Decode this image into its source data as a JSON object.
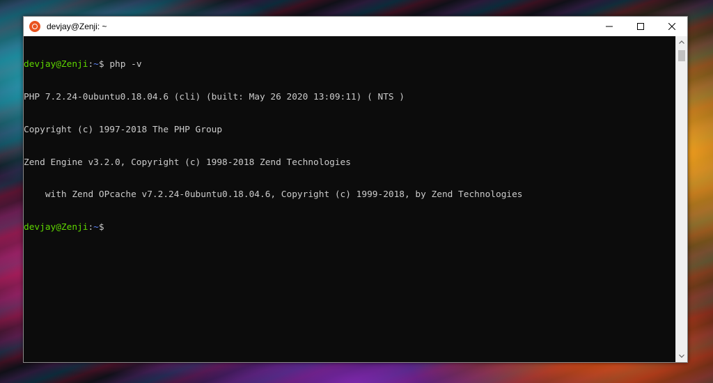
{
  "window": {
    "title": "devjay@Zenji: ~",
    "minimize_glyph": "—",
    "maximize_glyph": "☐",
    "close_glyph": "✕"
  },
  "terminal": {
    "lines": [
      {
        "user": "devjay@Zenji",
        "sep": ":",
        "path": "~",
        "prompt": "$ ",
        "cmd": "php -v"
      },
      {
        "text": "PHP 7.2.24-0ubuntu0.18.04.6 (cli) (built: May 26 2020 13:09:11) ( NTS )"
      },
      {
        "text": "Copyright (c) 1997-2018 The PHP Group"
      },
      {
        "text": "Zend Engine v3.2.0, Copyright (c) 1998-2018 Zend Technologies"
      },
      {
        "text": "    with Zend OPcache v7.2.24-0ubuntu0.18.04.6, Copyright (c) 1999-2018, by Zend Technologies"
      },
      {
        "user": "devjay@Zenji",
        "sep": ":",
        "path": "~",
        "prompt": "$",
        "cmd": ""
      }
    ]
  },
  "colors": {
    "prompt_user": "#5fd700",
    "prompt_path": "#5f87ff",
    "terminal_bg": "#0c0c0c",
    "terminal_fg": "#cccccc",
    "ubuntu_orange": "#e95420"
  },
  "icons": {
    "app": "ubuntu-logo-icon",
    "minimize": "minimize-icon",
    "maximize": "maximize-icon",
    "close": "close-icon"
  }
}
